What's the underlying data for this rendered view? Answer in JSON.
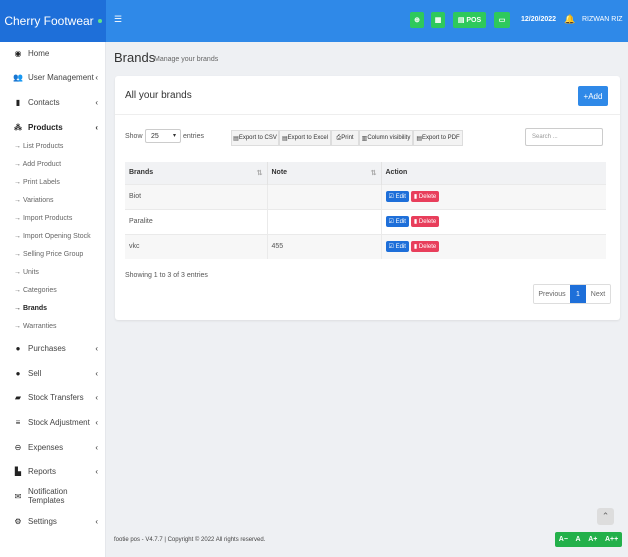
{
  "header": {
    "app_title": "Cherry Footwear",
    "menu_icon": "hamburger-icon",
    "pos_label": "POS",
    "date": "12/20/2022",
    "user": "RIZWAN RIZ",
    "colors": {
      "header_bg": "#2f89e8",
      "brand_bg": "#1e6fd9",
      "tool_btn": "#2ec95c"
    }
  },
  "sidebar": {
    "items": [
      {
        "label": "Home",
        "icon": "dashboard-icon",
        "chevron": false
      },
      {
        "label": "User Management",
        "icon": "users-icon",
        "chevron": true
      },
      {
        "label": "Contacts",
        "icon": "address-book-icon",
        "chevron": true
      },
      {
        "label": "Products",
        "icon": "cubes-icon",
        "chevron": true,
        "active": true
      },
      {
        "label": "Purchases",
        "icon": "arrow-circle-down-icon",
        "chevron": true
      },
      {
        "label": "Sell",
        "icon": "arrow-circle-up-icon",
        "chevron": true
      },
      {
        "label": "Stock Transfers",
        "icon": "truck-icon",
        "chevron": true
      },
      {
        "label": "Stock Adjustment",
        "icon": "database-icon",
        "chevron": true
      },
      {
        "label": "Expenses",
        "icon": "minus-circle-icon",
        "chevron": true
      },
      {
        "label": "Reports",
        "icon": "chart-icon",
        "chevron": true
      },
      {
        "label": "Notification Templates",
        "icon": "envelope-icon",
        "chevron": false
      },
      {
        "label": "Settings",
        "icon": "cog-icon",
        "chevron": true
      }
    ],
    "product_sub": [
      "List Products",
      "Add Product",
      "Print Labels",
      "Variations",
      "Import Products",
      "Import Opening Stock",
      "Selling Price Group",
      "Units",
      "Categories",
      "Brands",
      "Warranties"
    ],
    "active_sub": "Brands"
  },
  "page": {
    "title": "Brands",
    "subtitle": "Manage your brands"
  },
  "card": {
    "title": "All your brands",
    "add_label": "Add",
    "show_label": "Show",
    "show_value": "25",
    "entries_label": "entries",
    "export_buttons": [
      "Export to CSV",
      "Export to Excel",
      "Print",
      "Column visibility",
      "Export to PDF"
    ],
    "search_placeholder": "Search ..."
  },
  "table": {
    "columns": [
      "Brands",
      "Note",
      "Action"
    ],
    "rows": [
      {
        "brand": "Biot",
        "note": ""
      },
      {
        "brand": "Paralite",
        "note": ""
      },
      {
        "brand": "vkc",
        "note": "455"
      }
    ],
    "edit_label": "Edit",
    "delete_label": "Delete"
  },
  "info": "Showing 1 to 3 of 3 entries",
  "pagination": {
    "prev": "Previous",
    "current": "1",
    "next": "Next"
  },
  "footer": {
    "text": "footie pos - V4.7.7 | Copyright © 2022 All rights reserved.",
    "font_tools": [
      "A−",
      "A",
      "A+",
      "A++"
    ]
  }
}
